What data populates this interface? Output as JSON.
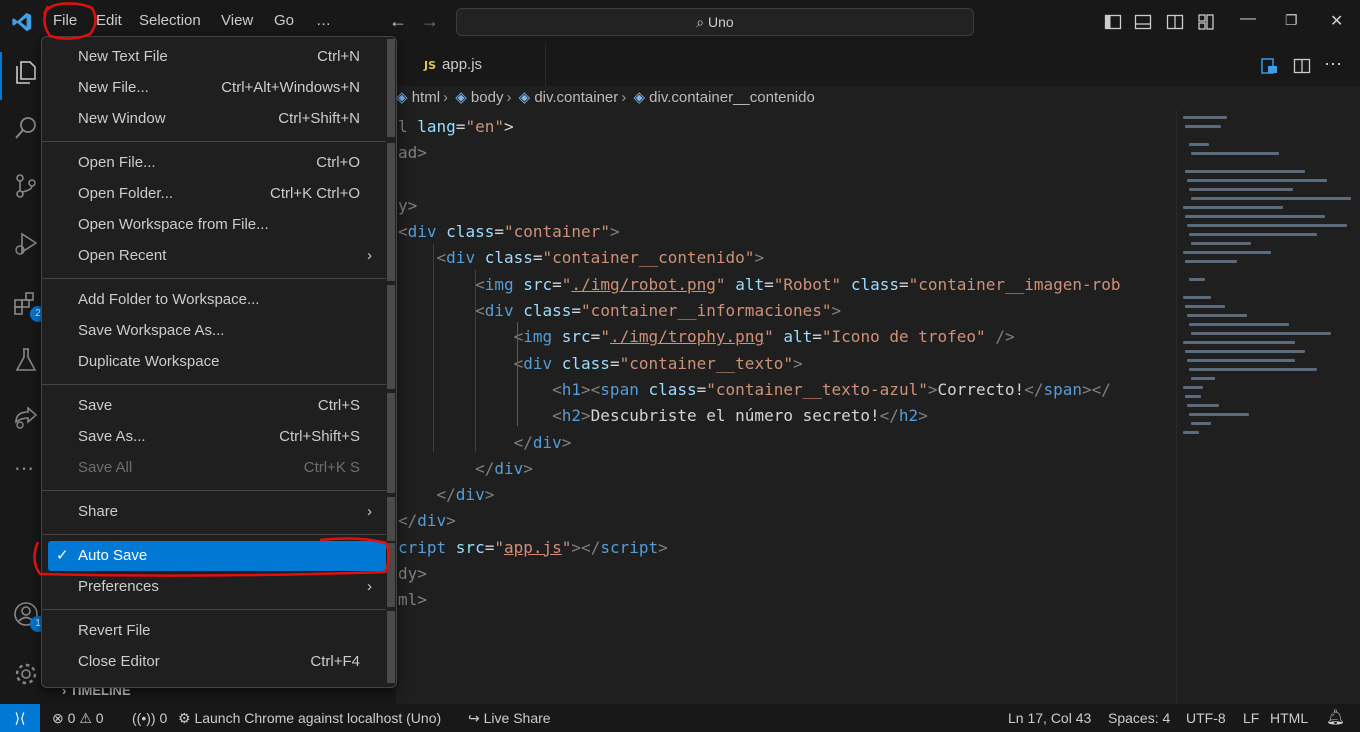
{
  "titlebar": {
    "menus": [
      "File",
      "Edit",
      "Selection",
      "View",
      "Go",
      "…"
    ],
    "search_text": "Uno"
  },
  "tab": {
    "badge": "JS",
    "label": "app.js"
  },
  "breadcrumbs": [
    "html",
    "body",
    "div.container",
    "div.container__contenido"
  ],
  "code_lines": [
    [
      [
        "pt",
        "l "
      ],
      [
        "at",
        "lang"
      ],
      [
        "tx",
        "="
      ],
      [
        "st",
        "\"en\""
      ],
      [
        "tx",
        ">"
      ]
    ],
    [
      [
        "pt",
        "ad>"
      ]
    ],
    [],
    [
      [
        "pt",
        "y>"
      ]
    ],
    [
      [
        "pt",
        "<"
      ],
      [
        "tg",
        "div "
      ],
      [
        "at",
        "class"
      ],
      [
        "tx",
        "="
      ],
      [
        "st",
        "\"container\""
      ],
      [
        "pt",
        ">"
      ]
    ],
    [
      [
        "tx",
        "    "
      ],
      [
        "pt",
        "<"
      ],
      [
        "tg",
        "div "
      ],
      [
        "at",
        "class"
      ],
      [
        "tx",
        "="
      ],
      [
        "st",
        "\"container__contenido\""
      ],
      [
        "pt",
        ">"
      ]
    ],
    [
      [
        "tx",
        "        "
      ],
      [
        "pt",
        "<"
      ],
      [
        "tg",
        "img "
      ],
      [
        "at",
        "src"
      ],
      [
        "tx",
        "="
      ],
      [
        "st",
        "\""
      ],
      [
        "stu",
        "./img/robot.png"
      ],
      [
        "st",
        "\""
      ],
      [
        "tx",
        " "
      ],
      [
        "at",
        "alt"
      ],
      [
        "tx",
        "="
      ],
      [
        "st",
        "\"Robot\""
      ],
      [
        "tx",
        " "
      ],
      [
        "at",
        "class"
      ],
      [
        "tx",
        "="
      ],
      [
        "st",
        "\"container__imagen-rob"
      ]
    ],
    [
      [
        "tx",
        "        "
      ],
      [
        "pt",
        "<"
      ],
      [
        "tg",
        "div "
      ],
      [
        "at",
        "class"
      ],
      [
        "tx",
        "="
      ],
      [
        "st",
        "\"container__informaciones\""
      ],
      [
        "pt",
        ">"
      ]
    ],
    [
      [
        "tx",
        "            "
      ],
      [
        "pt",
        "<"
      ],
      [
        "tg",
        "img "
      ],
      [
        "at",
        "src"
      ],
      [
        "tx",
        "="
      ],
      [
        "st",
        "\""
      ],
      [
        "stu",
        "./img/trophy.png"
      ],
      [
        "st",
        "\""
      ],
      [
        "tx",
        " "
      ],
      [
        "at",
        "alt"
      ],
      [
        "tx",
        "="
      ],
      [
        "st",
        "\"Icono de trofeo\""
      ],
      [
        "tx",
        " "
      ],
      [
        "pt",
        "/>"
      ]
    ],
    [
      [
        "tx",
        "            "
      ],
      [
        "pt",
        "<"
      ],
      [
        "tg",
        "div "
      ],
      [
        "at",
        "class"
      ],
      [
        "tx",
        "="
      ],
      [
        "st",
        "\"container__texto\""
      ],
      [
        "pt",
        ">"
      ]
    ],
    [
      [
        "tx",
        "                "
      ],
      [
        "pt",
        "<"
      ],
      [
        "tg",
        "h1"
      ],
      [
        "pt",
        "><"
      ],
      [
        "tg",
        "span "
      ],
      [
        "at",
        "class"
      ],
      [
        "tx",
        "="
      ],
      [
        "st",
        "\"container__texto-azul\""
      ],
      [
        "pt",
        ">"
      ],
      [
        "tx",
        "Correcto!"
      ],
      [
        "pt",
        "</"
      ],
      [
        "tg",
        "span"
      ],
      [
        "pt",
        "></"
      ]
    ],
    [
      [
        "tx",
        "                "
      ],
      [
        "pt",
        "<"
      ],
      [
        "tg",
        "h2"
      ],
      [
        "pt",
        ">"
      ],
      [
        "tx",
        "Descubriste el número secreto!"
      ],
      [
        "pt",
        "</"
      ],
      [
        "tg",
        "h2"
      ],
      [
        "pt",
        ">"
      ]
    ],
    [
      [
        "tx",
        "            "
      ],
      [
        "pt",
        "</"
      ],
      [
        "tg",
        "div"
      ],
      [
        "pt",
        ">"
      ]
    ],
    [
      [
        "tx",
        "        "
      ],
      [
        "pt",
        "</"
      ],
      [
        "tg",
        "div"
      ],
      [
        "pt",
        ">"
      ]
    ],
    [
      [
        "tx",
        "    "
      ],
      [
        "pt",
        "</"
      ],
      [
        "tg",
        "div"
      ],
      [
        "pt",
        ">"
      ]
    ],
    [
      [
        "pt",
        "</"
      ],
      [
        "tg",
        "div"
      ],
      [
        "pt",
        ">"
      ]
    ],
    [
      [
        "tg",
        "cript "
      ],
      [
        "at",
        "src"
      ],
      [
        "tx",
        "="
      ],
      [
        "st",
        "\""
      ],
      [
        "stu",
        "app.js"
      ],
      [
        "st",
        "\""
      ],
      [
        "pt",
        "></"
      ],
      [
        "tg",
        "script"
      ],
      [
        "pt",
        ">"
      ]
    ],
    [
      [
        "pt",
        "dy>"
      ]
    ],
    [
      [
        "pt",
        "ml>"
      ]
    ]
  ],
  "file_menu": {
    "items": [
      {
        "label": "New Text File",
        "shortcut": "Ctrl+N"
      },
      {
        "label": "New File...",
        "shortcut": "Ctrl+Alt+Windows+N"
      },
      {
        "label": "New Window",
        "shortcut": "Ctrl+Shift+N"
      },
      {
        "label": "Open File...",
        "shortcut": "Ctrl+O"
      },
      {
        "label": "Open Folder...",
        "shortcut": "Ctrl+K Ctrl+O"
      },
      {
        "label": "Open Workspace from File...",
        "shortcut": ""
      },
      {
        "label": "Open Recent",
        "shortcut": "",
        "submenu": true
      },
      {
        "label": "Add Folder to Workspace...",
        "shortcut": ""
      },
      {
        "label": "Save Workspace As...",
        "shortcut": ""
      },
      {
        "label": "Duplicate Workspace",
        "shortcut": ""
      },
      {
        "label": "Save",
        "shortcut": "Ctrl+S"
      },
      {
        "label": "Save As...",
        "shortcut": "Ctrl+Shift+S"
      },
      {
        "label": "Save All",
        "shortcut": "Ctrl+K S",
        "disabled": true
      },
      {
        "label": "Share",
        "shortcut": "",
        "submenu": true
      },
      {
        "label": "Auto Save",
        "shortcut": "",
        "checked": true,
        "selected": true
      },
      {
        "label": "Preferences",
        "shortcut": "",
        "submenu": true
      },
      {
        "label": "Revert File",
        "shortcut": ""
      },
      {
        "label": "Close Editor",
        "shortcut": "Ctrl+F4"
      }
    ]
  },
  "timeline_label": "TIMELINE",
  "statusbar": {
    "errors": "0",
    "warnings": "0",
    "ports": "0",
    "launch": "Launch Chrome against localhost (Uno)",
    "live_share": "Live Share",
    "position": "Ln 17, Col 43",
    "spaces": "Spaces: 4",
    "encoding": "UTF-8",
    "eol": "LF",
    "language": "HTML"
  },
  "badges": {
    "extensions": "2",
    "accounts": "1"
  },
  "colors": {
    "accent": "#0078d4",
    "annotation": "#e01010"
  }
}
